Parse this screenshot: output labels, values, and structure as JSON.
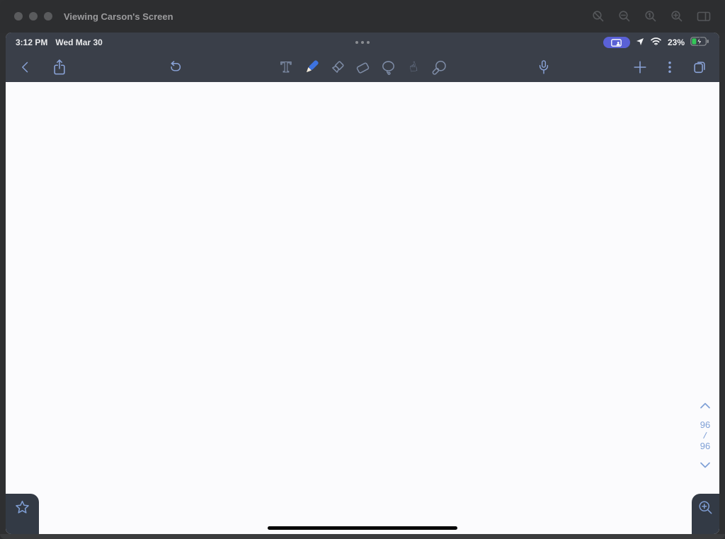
{
  "window": {
    "title": "Viewing Carson's Screen",
    "titlebar_tools": [
      "zoom-disabled",
      "zoom-out",
      "zoom-actual-size",
      "zoom-in",
      "display"
    ]
  },
  "statusbar": {
    "time": "3:12 PM",
    "date": "Wed Mar 30",
    "battery_percent": "23%",
    "battery_charging": true,
    "screen_share_indicator": true
  },
  "toolbar": {
    "text_tool_glyph": "T",
    "tools": [
      "text",
      "pen",
      "highlighter",
      "eraser",
      "lasso",
      "pointer",
      "laser-pointer"
    ],
    "selected_tool": "pen",
    "left_actions": [
      "back",
      "share"
    ],
    "mid_actions": [
      "undo"
    ],
    "right_actions": [
      "record-audio",
      "add-page",
      "more-options",
      "pages-overview"
    ]
  },
  "page_nav": {
    "current": "96",
    "separator": "/",
    "total": "96"
  },
  "colors": {
    "chrome": "#3a3f49",
    "accent_blue": "#8aa3d8",
    "selected_pen": "#3d73e0",
    "canvas": "#fbfbfd",
    "share_pill": "#5a61d6",
    "battery_green": "#34c759",
    "page_nav_blue": "#7fa0d6"
  }
}
